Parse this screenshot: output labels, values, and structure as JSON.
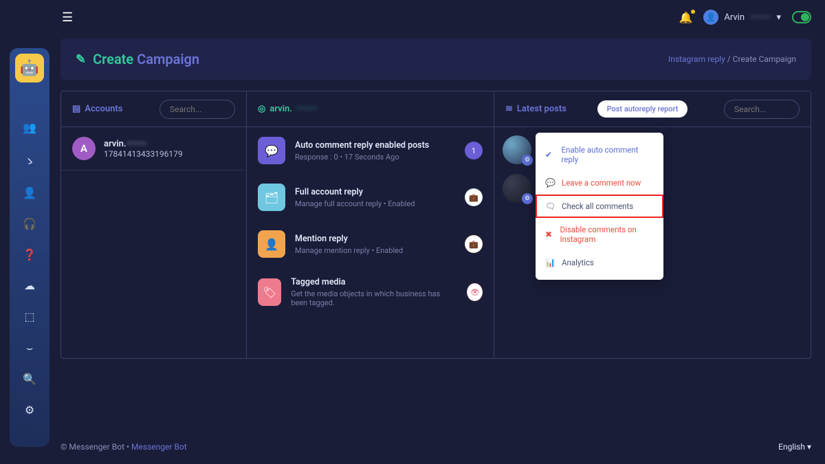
{
  "topbar": {
    "user_name": "Arvin",
    "user_name_blur": "———"
  },
  "page": {
    "title_create": "Create",
    "title_campaign": "Campaign",
    "breadcrumb_parent": "Instagram reply",
    "breadcrumb_sep": " / ",
    "breadcrumb_current": "Create Campaign"
  },
  "panel_accounts": {
    "title": "Accounts",
    "search_placeholder": "Search...",
    "items": [
      {
        "initial": "A",
        "name": "arvin.",
        "name_blur": "———",
        "id": "17841413433196179"
      }
    ]
  },
  "panel_tools": {
    "title_prefix": "arvin.",
    "title_blur": "———",
    "rows": [
      {
        "icon_bg": "#6b5ed6",
        "icon": "💬",
        "title": "Auto comment reply enabled posts",
        "sub_a": "Response : 0",
        "sub_b": "17 Seconds Ago",
        "badge_bg": "#6b5ed6",
        "badge_fg": "#fff",
        "badge_text": "1"
      },
      {
        "icon_bg": "#6fc8e0",
        "icon": "🗂",
        "title": "Full account reply",
        "sub_a": "Manage full account reply",
        "sub_b": "Enabled",
        "badge_bg": "#fff",
        "badge_fg": "#3ea8c9",
        "badge_text": "💼"
      },
      {
        "icon_bg": "#f2a44d",
        "icon": "👤",
        "title": "Mention reply",
        "sub_a": "Manage mention reply",
        "sub_b": "Enabled",
        "badge_bg": "#fff",
        "badge_fg": "#f2a44d",
        "badge_text": "💼"
      },
      {
        "icon_bg": "#f07a8d",
        "icon": "🏷",
        "title": "Tagged media",
        "sub_a": "Get the media objects in which business has been tagged.",
        "sub_b": "",
        "badge_bg": "#fff",
        "badge_fg": "#d94f6a",
        "badge_text": "👁"
      }
    ]
  },
  "panel_posts": {
    "title": "Latest posts",
    "report_btn": "Post autoreply report",
    "search_placeholder": "Search...",
    "menu": [
      {
        "icon": "✔",
        "label": "Enable auto comment reply",
        "cls": "blue"
      },
      {
        "icon": "💬",
        "label": "Leave a comment now",
        "cls": "red"
      },
      {
        "icon": "🗨",
        "label": "Check all comments",
        "cls": "highlight"
      },
      {
        "icon": "✖",
        "label": "Disable comments on Instagram",
        "cls": "red"
      },
      {
        "icon": "📊",
        "label": "Analytics",
        "cls": ""
      }
    ]
  },
  "footer": {
    "copyright": "© Messenger Bot",
    "dot": " • ",
    "link": "Messenger Bot",
    "language": "English"
  }
}
